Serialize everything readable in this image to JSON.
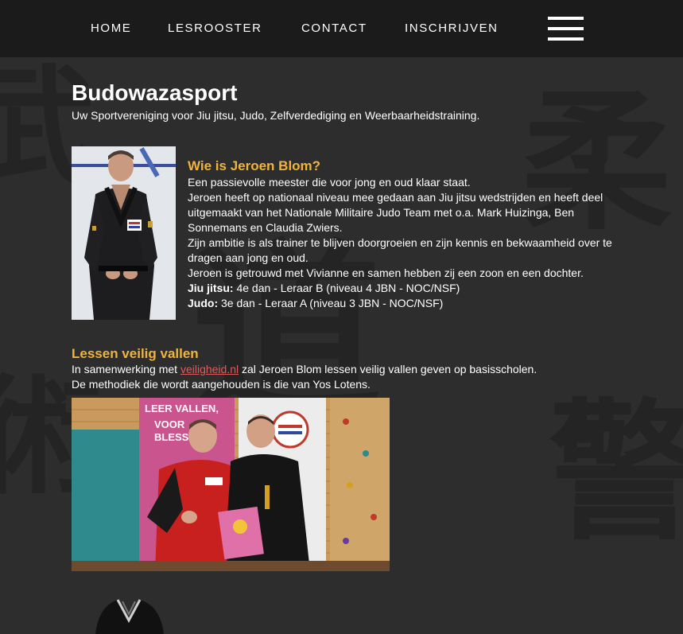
{
  "nav": {
    "items": [
      {
        "label": "HOME"
      },
      {
        "label": "LESROOSTER"
      },
      {
        "label": "CONTACT"
      },
      {
        "label": "INSCHRIJVEN"
      }
    ],
    "menu_icon": "hamburger-menu-icon"
  },
  "header": {
    "title": "Budowazasport",
    "subtitle": "Uw Sportvereniging voor Jiu jitsu, Judo, Zelfverdediging en Weerbaarheidstraining."
  },
  "bio": {
    "heading": "Wie is Jeroen Blom?",
    "lines": [
      "Een passievolle meester die voor jong en oud klaar staat.",
      "Jeroen heeft op nationaal niveau mee gedaan aan Jiu jitsu wedstrijden en heeft deel uitgemaakt van het Nationale Militaire Judo Team met o.a. Mark Huizinga, Ben Sonnemans en Claudia Zwiers.",
      "Zijn ambitie is als trainer te blijven doorgroeien en zijn kennis en bekwaamheid over te dragen aan jong en oud.",
      "Jeroen is getrouwd met Vivianne en samen hebben zij een zoon en een dochter."
    ],
    "jiujitsu_label": "Jiu jitsu:",
    "jiujitsu_value": " 4e dan - Leraar B (niveau 4 JBN - NOC/NSF)",
    "judo_label": "Judo:",
    "judo_value": " 3e dan - Leraar A (niveau 3 JBN - NOC/NSF)"
  },
  "lessen": {
    "heading": "Lessen veilig vallen",
    "line1_before": "In samenwerking met ",
    "line1_link": "veiligheid.nl",
    "line1_after": " zal Jeroen Blom lessen veilig vallen geven op basisscholen.",
    "line2": "De methodiek die wordt aangehouden is die van Yos Lotens."
  },
  "colors": {
    "background": "#2d2d2d",
    "topbar": "#1b1b1b",
    "heading_accent": "#f0b43c",
    "link": "#e05a5a"
  },
  "background_watermark": [
    "柔",
    "警",
    "道",
    "武",
    "術"
  ],
  "images": {
    "jeroen_photo": "photo-jeroen-blom",
    "lessen_photo": "photo-leer-vallen",
    "banner_text_1": "LEER VALLEN,",
    "banner_text_2": "VOOR",
    "banner_text_3": "BLESS",
    "gi_photo": "black-gi-image"
  }
}
